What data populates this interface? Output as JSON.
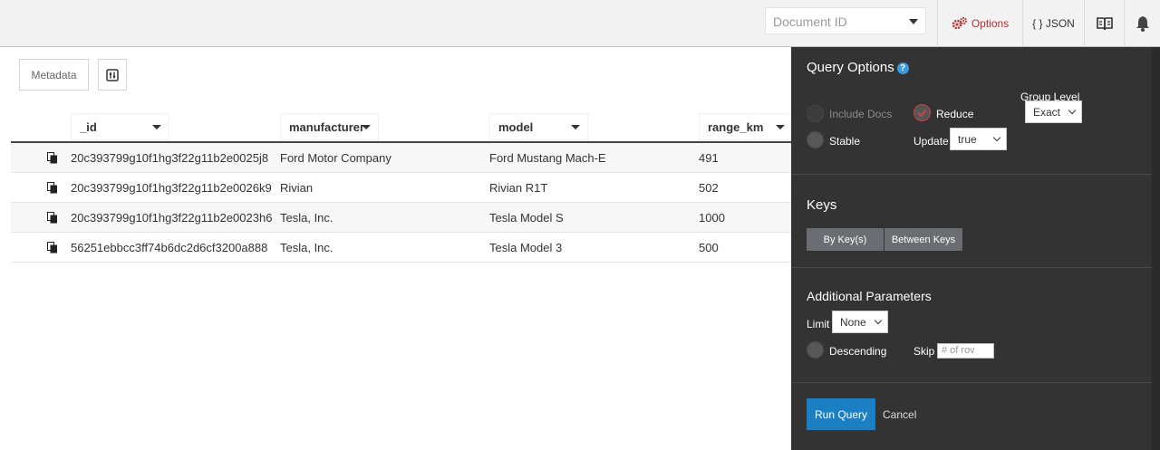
{
  "header": {
    "doc_id_placeholder": "Document ID",
    "options_label": "Options",
    "json_label": "{ } JSON",
    "accent_color": "#b03030"
  },
  "toolbar": {
    "metadata_label": "Metadata"
  },
  "table": {
    "columns": [
      "_id",
      "manufacturer",
      "model",
      "range_km"
    ],
    "rows": [
      [
        "20c393799g10f1hg3f22g11b2e0025j8",
        "Ford Motor Company",
        "Ford Mustang Mach-E",
        "491"
      ],
      [
        "20c393799g10f1hg3f22g11b2e0026k9",
        "Rivian",
        "Rivian R1T",
        "502"
      ],
      [
        "20c393799g10f1hg3f22g11b2e0023h6",
        "Tesla, Inc.",
        "Tesla Model S",
        "1000"
      ],
      [
        "56251ebbcc3ff74b6dc2d6cf3200a888",
        "Tesla, Inc.",
        "Tesla Model 3",
        "500"
      ]
    ]
  },
  "query_options": {
    "title": "Query Options",
    "help_glyph": "?",
    "include_docs_label": "Include Docs",
    "reduce_label": "Reduce",
    "group_level_label": "Group Level",
    "group_level_value": "Exact",
    "stable_label": "Stable",
    "update_label": "Update",
    "update_value": "true",
    "keys_title": "Keys",
    "by_keys_label": "By Key(s)",
    "between_keys_label": "Between Keys",
    "additional_title": "Additional Parameters",
    "limit_label": "Limit",
    "limit_value": "None",
    "descending_label": "Descending",
    "skip_label": "Skip",
    "skip_placeholder": "# of rov",
    "run_label": "Run Query",
    "cancel_label": "Cancel",
    "run_color": "#1b7fc4"
  }
}
